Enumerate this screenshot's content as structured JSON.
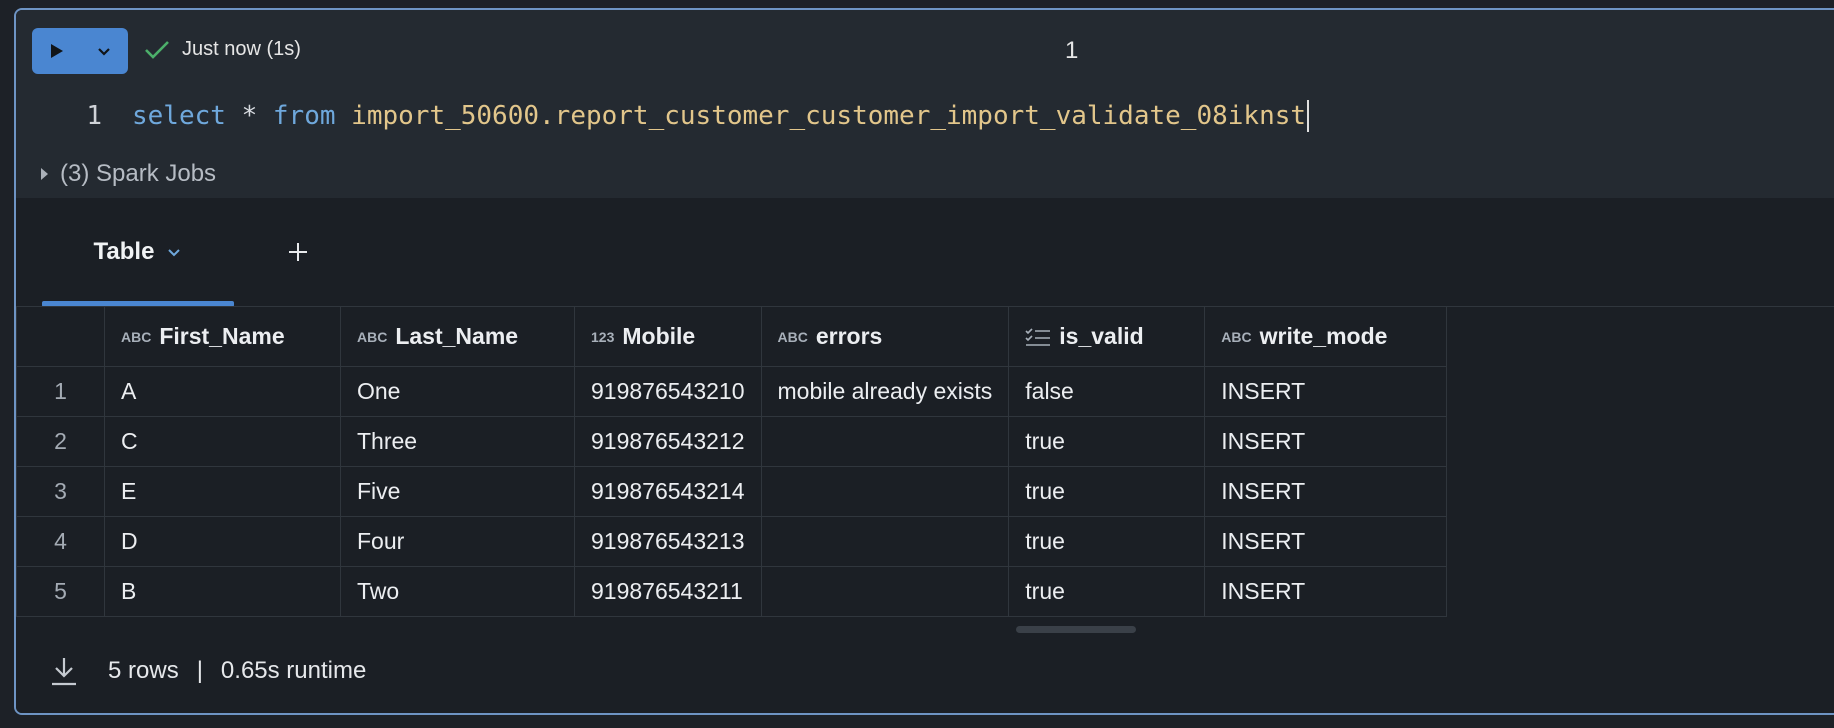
{
  "toolbar": {
    "status_text": "Just now (1s)",
    "cell_number": "1"
  },
  "editor": {
    "line_number": "1",
    "code": {
      "kw_select": "select",
      "star": "*",
      "kw_from": "from",
      "table_ref": "import_50600.report_customer_customer_import_validate_08iknst"
    },
    "spark_jobs": "(3) Spark Jobs"
  },
  "results": {
    "tab_label": "Table",
    "columns": [
      {
        "name": "First_Name",
        "type_icon": "string-type-icon"
      },
      {
        "name": "Last_Name",
        "type_icon": "string-type-icon"
      },
      {
        "name": "Mobile",
        "type_icon": "number-type-icon"
      },
      {
        "name": "errors",
        "type_icon": "string-type-icon"
      },
      {
        "name": "is_valid",
        "type_icon": "boolean-type-icon"
      },
      {
        "name": "write_mode",
        "type_icon": "string-type-icon"
      }
    ],
    "rows": [
      {
        "n": "1",
        "cells": [
          "A",
          "One",
          "919876543210",
          "mobile already exists",
          "false",
          "INSERT"
        ]
      },
      {
        "n": "2",
        "cells": [
          "C",
          "Three",
          "919876543212",
          "",
          "true",
          "INSERT"
        ]
      },
      {
        "n": "3",
        "cells": [
          "E",
          "Five",
          "919876543214",
          "",
          "true",
          "INSERT"
        ]
      },
      {
        "n": "4",
        "cells": [
          "D",
          "Four",
          "919876543213",
          "",
          "true",
          "INSERT"
        ]
      },
      {
        "n": "5",
        "cells": [
          "B",
          "Two",
          "919876543211",
          "",
          "true",
          "INSERT"
        ]
      }
    ],
    "footer": {
      "rows_text": "5 rows",
      "separator": "|",
      "runtime_text": "0.65s runtime"
    }
  }
}
